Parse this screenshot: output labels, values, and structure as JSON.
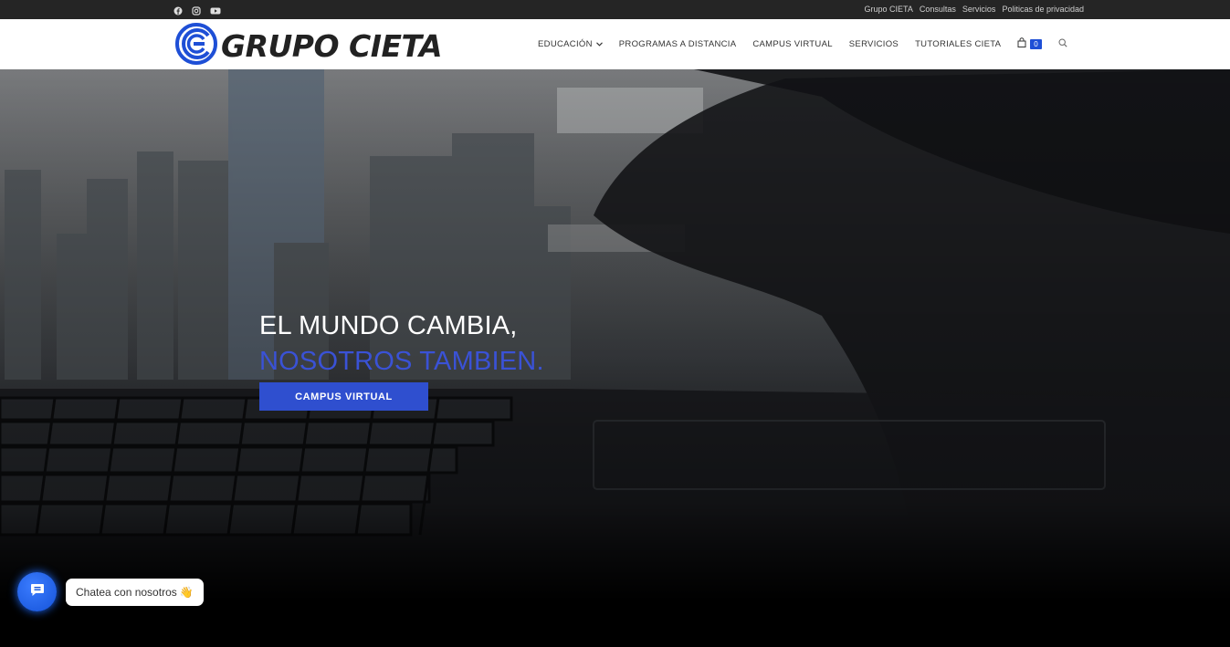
{
  "topbar": {
    "social_icons": [
      "facebook-icon",
      "instagram-icon",
      "youtube-icon"
    ],
    "links": [
      "Grupo CIETA",
      "Consultas",
      "Servicios",
      "Politicas de privacidad"
    ]
  },
  "header": {
    "logo_text": "GRUPO CIETA",
    "nav": {
      "educacion": "EDUCACIÓN",
      "programas": "PROGRAMAS A DISTANCIA",
      "campus": "CAMPUS VIRTUAL",
      "servicios": "SERVICIOS",
      "tutoriales": "TUTORIALES CIETA"
    },
    "cart_count": "0"
  },
  "hero": {
    "line1": "EL MUNDO CAMBIA,",
    "line2": "NOSOTROS TAMBIEN.",
    "cta_label": "CAMPUS VIRTUAL"
  },
  "chat": {
    "label": "Chatea con nosotros",
    "emoji": "👋"
  },
  "colors": {
    "accent": "#2f4fcf",
    "topbar": "#252525",
    "header": "#ffffff"
  }
}
